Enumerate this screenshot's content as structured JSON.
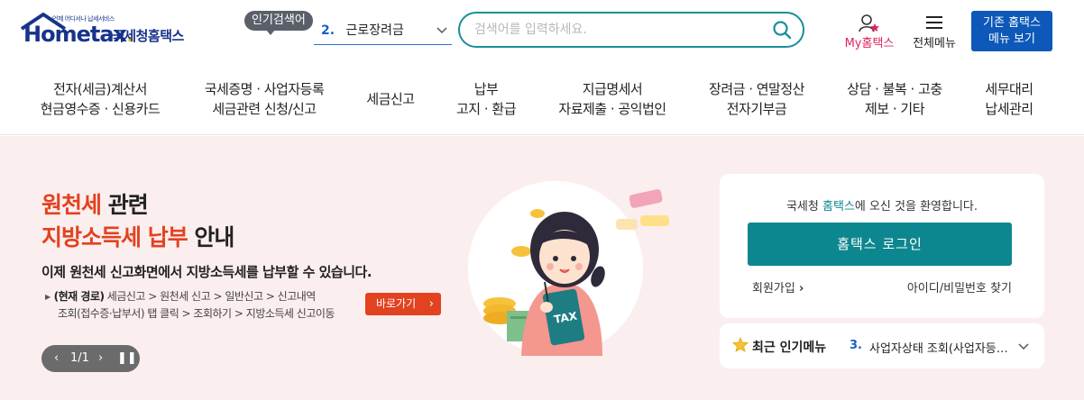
{
  "header": {
    "logo": {
      "brand": "Hometax",
      "tagline": "언제 어디서나 납세서비스",
      "name": "국세청홈택스"
    },
    "popular_search": {
      "badge": "인기검색어",
      "rank": "2.",
      "term": "근로장려금"
    },
    "search": {
      "placeholder": "검색어를 입력하세요.",
      "value": ""
    },
    "my_home": "My홈택스",
    "all_menu": "전체메뉴",
    "legacy_button": {
      "line1": "기존 홈택스",
      "line2": "메뉴 보기"
    }
  },
  "gnb": [
    {
      "line1": "전자(세금)계산서",
      "line2": "현금영수증 · 신용카드"
    },
    {
      "line1": "국세증명 · 사업자등록",
      "line2": "세금관련 신청/신고"
    },
    {
      "line1": "세금신고",
      "line2": ""
    },
    {
      "line1": "납부",
      "line2": "고지 · 환급"
    },
    {
      "line1": "지급명세서",
      "line2": "자료제출 · 공익법인"
    },
    {
      "line1": "장려금 · 연말정산",
      "line2": "전자기부금"
    },
    {
      "line1": "상담 · 불복 · 고충",
      "line2": "제보 · 기타"
    },
    {
      "line1": "세무대리",
      "line2": "납세관리"
    }
  ],
  "banner": {
    "title1_red": "원천세",
    "title1_rest": " 관련",
    "title2_red": "지방소득세 납부",
    "title2_rest": " 안내",
    "description": "이제 원천세 신고화면에서 지방소득세를 납부할 수 있습니다.",
    "path_label": "(현재 경로)",
    "path_line1": " 세금신고 > 원천세 신고 > 일반신고 > 신고내역",
    "path_line2": "조회(접수증·납부서) 탭 클릭 > 조회하기 > 지방소득세 신고이동",
    "shortcut": "바로가기",
    "pager": "1/1",
    "illustration_text": "TAX"
  },
  "login": {
    "welcome_pre": "국세청 ",
    "welcome_hl": "홈택스",
    "welcome_post": "에 오신 것을 환영합니다.",
    "button": "홈택스 로그인",
    "join": "회원가입",
    "find": "아이디/비밀번호 찾기"
  },
  "popular_menu": {
    "title": "최근 인기메뉴",
    "rank": "3.",
    "item": "사업자상태 조회(사업자등록번호)"
  },
  "colors": {
    "brand": "#17338b",
    "accent_red": "#e2421f",
    "teal": "#0d878f",
    "banner_bg": "#fbeeee",
    "legacy_blue": "#0d58b8"
  }
}
